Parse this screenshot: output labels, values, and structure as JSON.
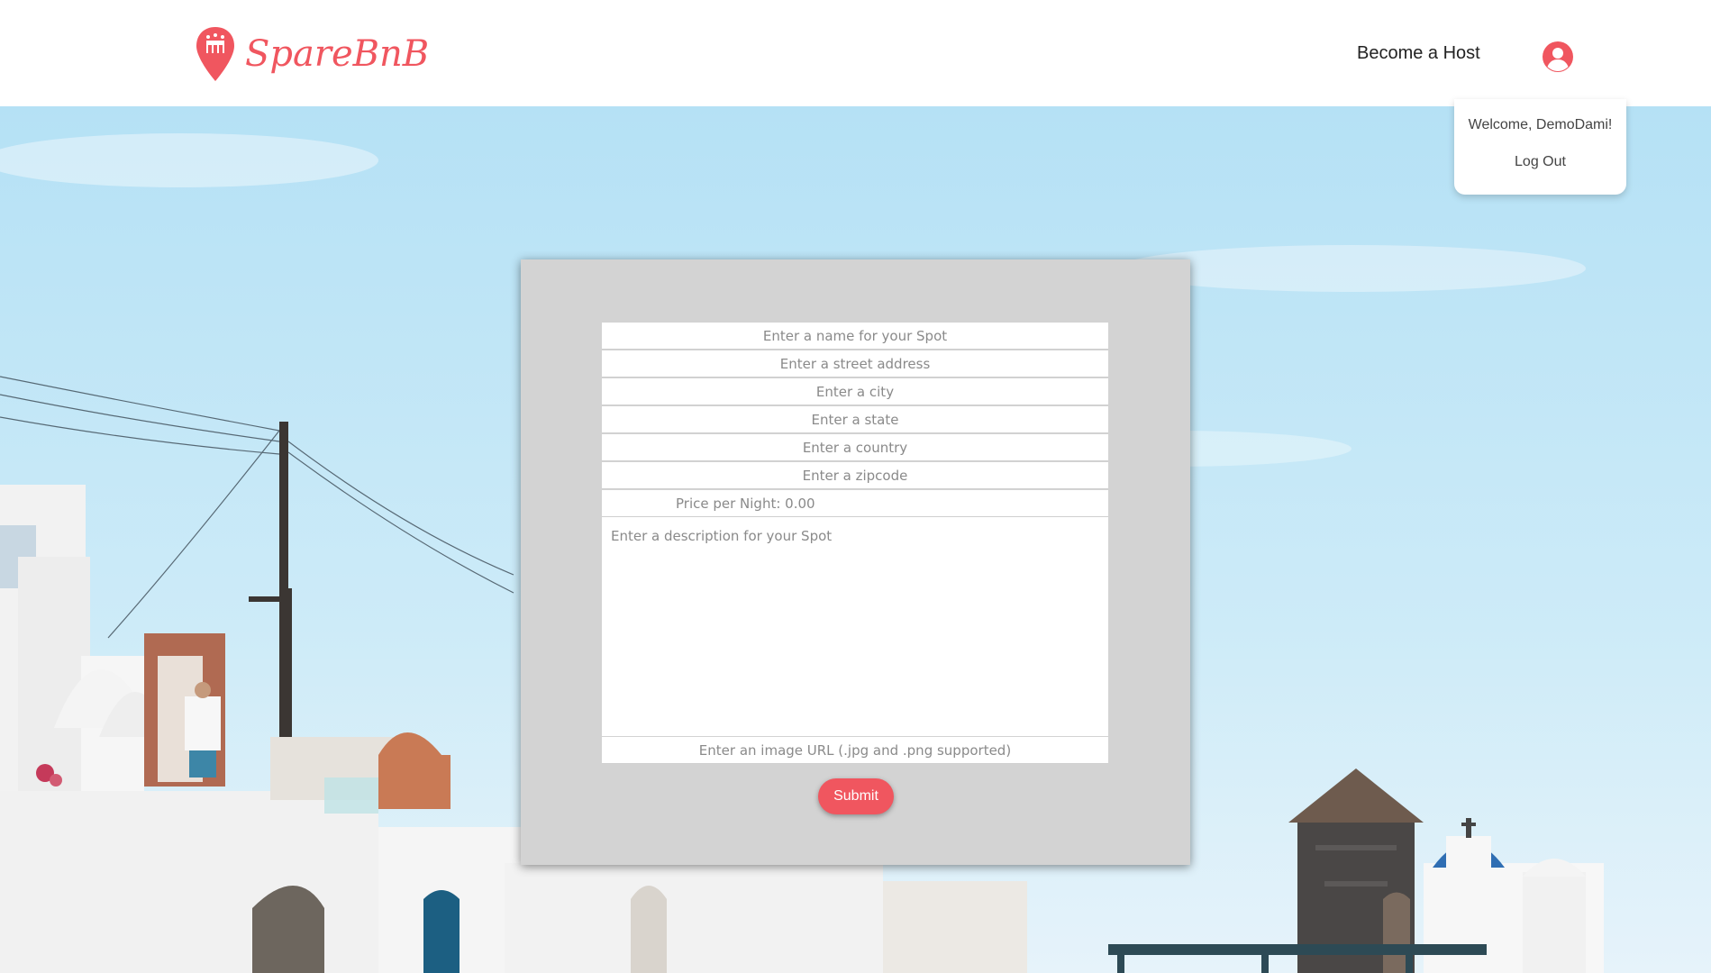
{
  "brand": {
    "name": "SpareBnB",
    "accent_color": "#f0565f"
  },
  "nav": {
    "become_host_label": "Become a Host",
    "profile_icon": "user-circle-icon"
  },
  "dropdown": {
    "welcome_text": "Welcome, DemoDami!",
    "logout_label": "Log Out"
  },
  "form": {
    "name_placeholder": "Enter a name for your Spot",
    "address_placeholder": "Enter a street address",
    "city_placeholder": "Enter a city",
    "state_placeholder": "Enter a state",
    "country_placeholder": "Enter a country",
    "zipcode_placeholder": "Enter a zipcode",
    "price_placeholder": "Price per Night: 0.00",
    "description_placeholder": "Enter a description for your Spot",
    "image_url_placeholder": "Enter an image URL (.jpg and .png supported)",
    "submit_label": "Submit"
  }
}
